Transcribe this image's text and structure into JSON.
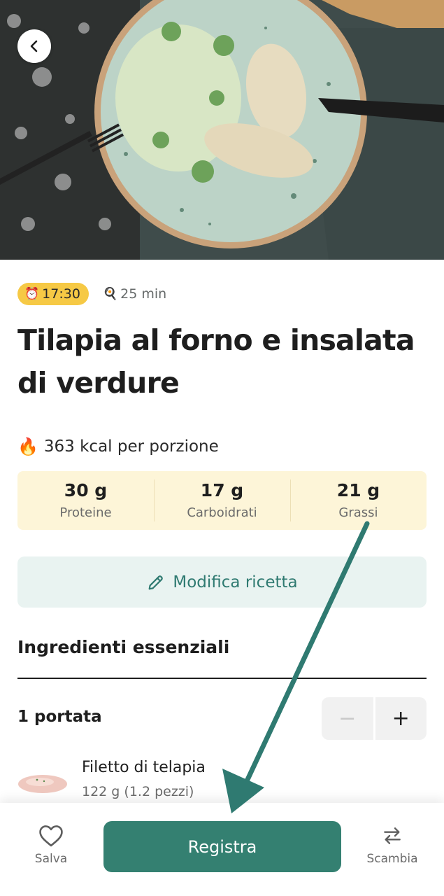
{
  "recipe": {
    "time_badge": "17:30",
    "duration": "25 min",
    "title": "Tilapia al forno e insalata di verdure",
    "kcal": "363 kcal per porzione",
    "macros": [
      {
        "value": "30 g",
        "label": "Proteine"
      },
      {
        "value": "17 g",
        "label": "Carboidrati"
      },
      {
        "value": "21 g",
        "label": "Grassi"
      }
    ],
    "edit_label": "Modifica ricetta"
  },
  "ingredients": {
    "section_title": "Ingredienti essenziali",
    "serving_label": "1 portata",
    "minus": "−",
    "plus": "+",
    "items": [
      {
        "name": "Filetto di telapia",
        "qty": "122 g (1.2 pezzi)"
      }
    ]
  },
  "bottom_bar": {
    "save_label": "Salva",
    "register_label": "Registra",
    "swap_label": "Scambia"
  },
  "icons": {
    "back": "chevron-left-icon",
    "time": "alarm-clock-icon",
    "duration": "pan-icon",
    "kcal": "fire-icon",
    "edit": "pencil-icon",
    "save": "heart-icon",
    "swap": "swap-arrows-icon"
  },
  "colors": {
    "accent": "#348071",
    "badge": "#f6c945",
    "macro_bg": "#fdf5d8",
    "edit_bg": "#e9f3f1",
    "arrow": "#2f7a71"
  }
}
